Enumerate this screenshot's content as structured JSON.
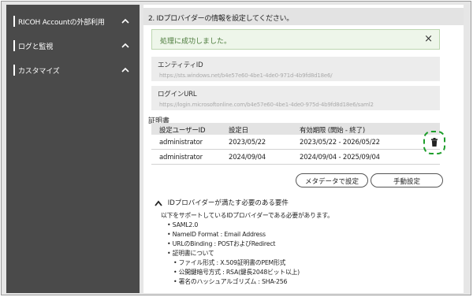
{
  "sidebar": {
    "items": [
      {
        "label": "RICOH Accountの外部利用"
      },
      {
        "label": "ログと監視"
      },
      {
        "label": "カスタマイズ"
      }
    ]
  },
  "main": {
    "section_title": "2. IDプロバイダーの情報を設定してください。",
    "success_message": "処理に成功しました。",
    "close_glyph": "×",
    "entity_id": {
      "label": "エンティティID",
      "value": "https://sts.windows.net/b4e57e60-4be1-4de0-971d-4b9fd8d18e6/"
    },
    "login_url": {
      "label": "ログインURL",
      "value": "https://login.microsoftonline.com/b4e57e60-4be1-4de0-975d-4b9fd8d18e6/saml2"
    },
    "certificate": {
      "title": "証明書",
      "headers": [
        "設定ユーザーID",
        "設定日",
        "有効期限 (開始 - 終了)"
      ],
      "rows": [
        {
          "user": "administrator",
          "date": "2023/05/22",
          "validity": "2023/05/22 - 2026/05/22"
        },
        {
          "user": "administrator",
          "date": "2024/09/04",
          "validity": "2024/09/04 - 2025/09/04"
        }
      ]
    },
    "buttons": {
      "metadata": "メタデータで設定",
      "manual": "手動設定"
    },
    "requirements": {
      "heading": "IDプロバイダーが満たす必要のある要件",
      "intro": "以下をサポートしているIDプロバイダーである必要があります。",
      "items": [
        "• SAML2.0",
        "• NameID Format : Email Address",
        "• URLのBinding : POSTおよびRedirect",
        "• 証明書について"
      ],
      "sub_items": [
        "• ファイル形式 : X.509証明書のPEM形式",
        "• 公開鍵暗号方式 : RSA(鍵長2048ビット以上)",
        "• 署名のハッシュアルゴリズム : SHA-256"
      ]
    }
  },
  "colors": {
    "sidebar_bg": "#4a4a4a",
    "highlight": "#1e9e2c",
    "success_bg": "#eef6ea"
  },
  "icons": [
    "chevron-up-icon",
    "close-icon",
    "trash-icon"
  ]
}
